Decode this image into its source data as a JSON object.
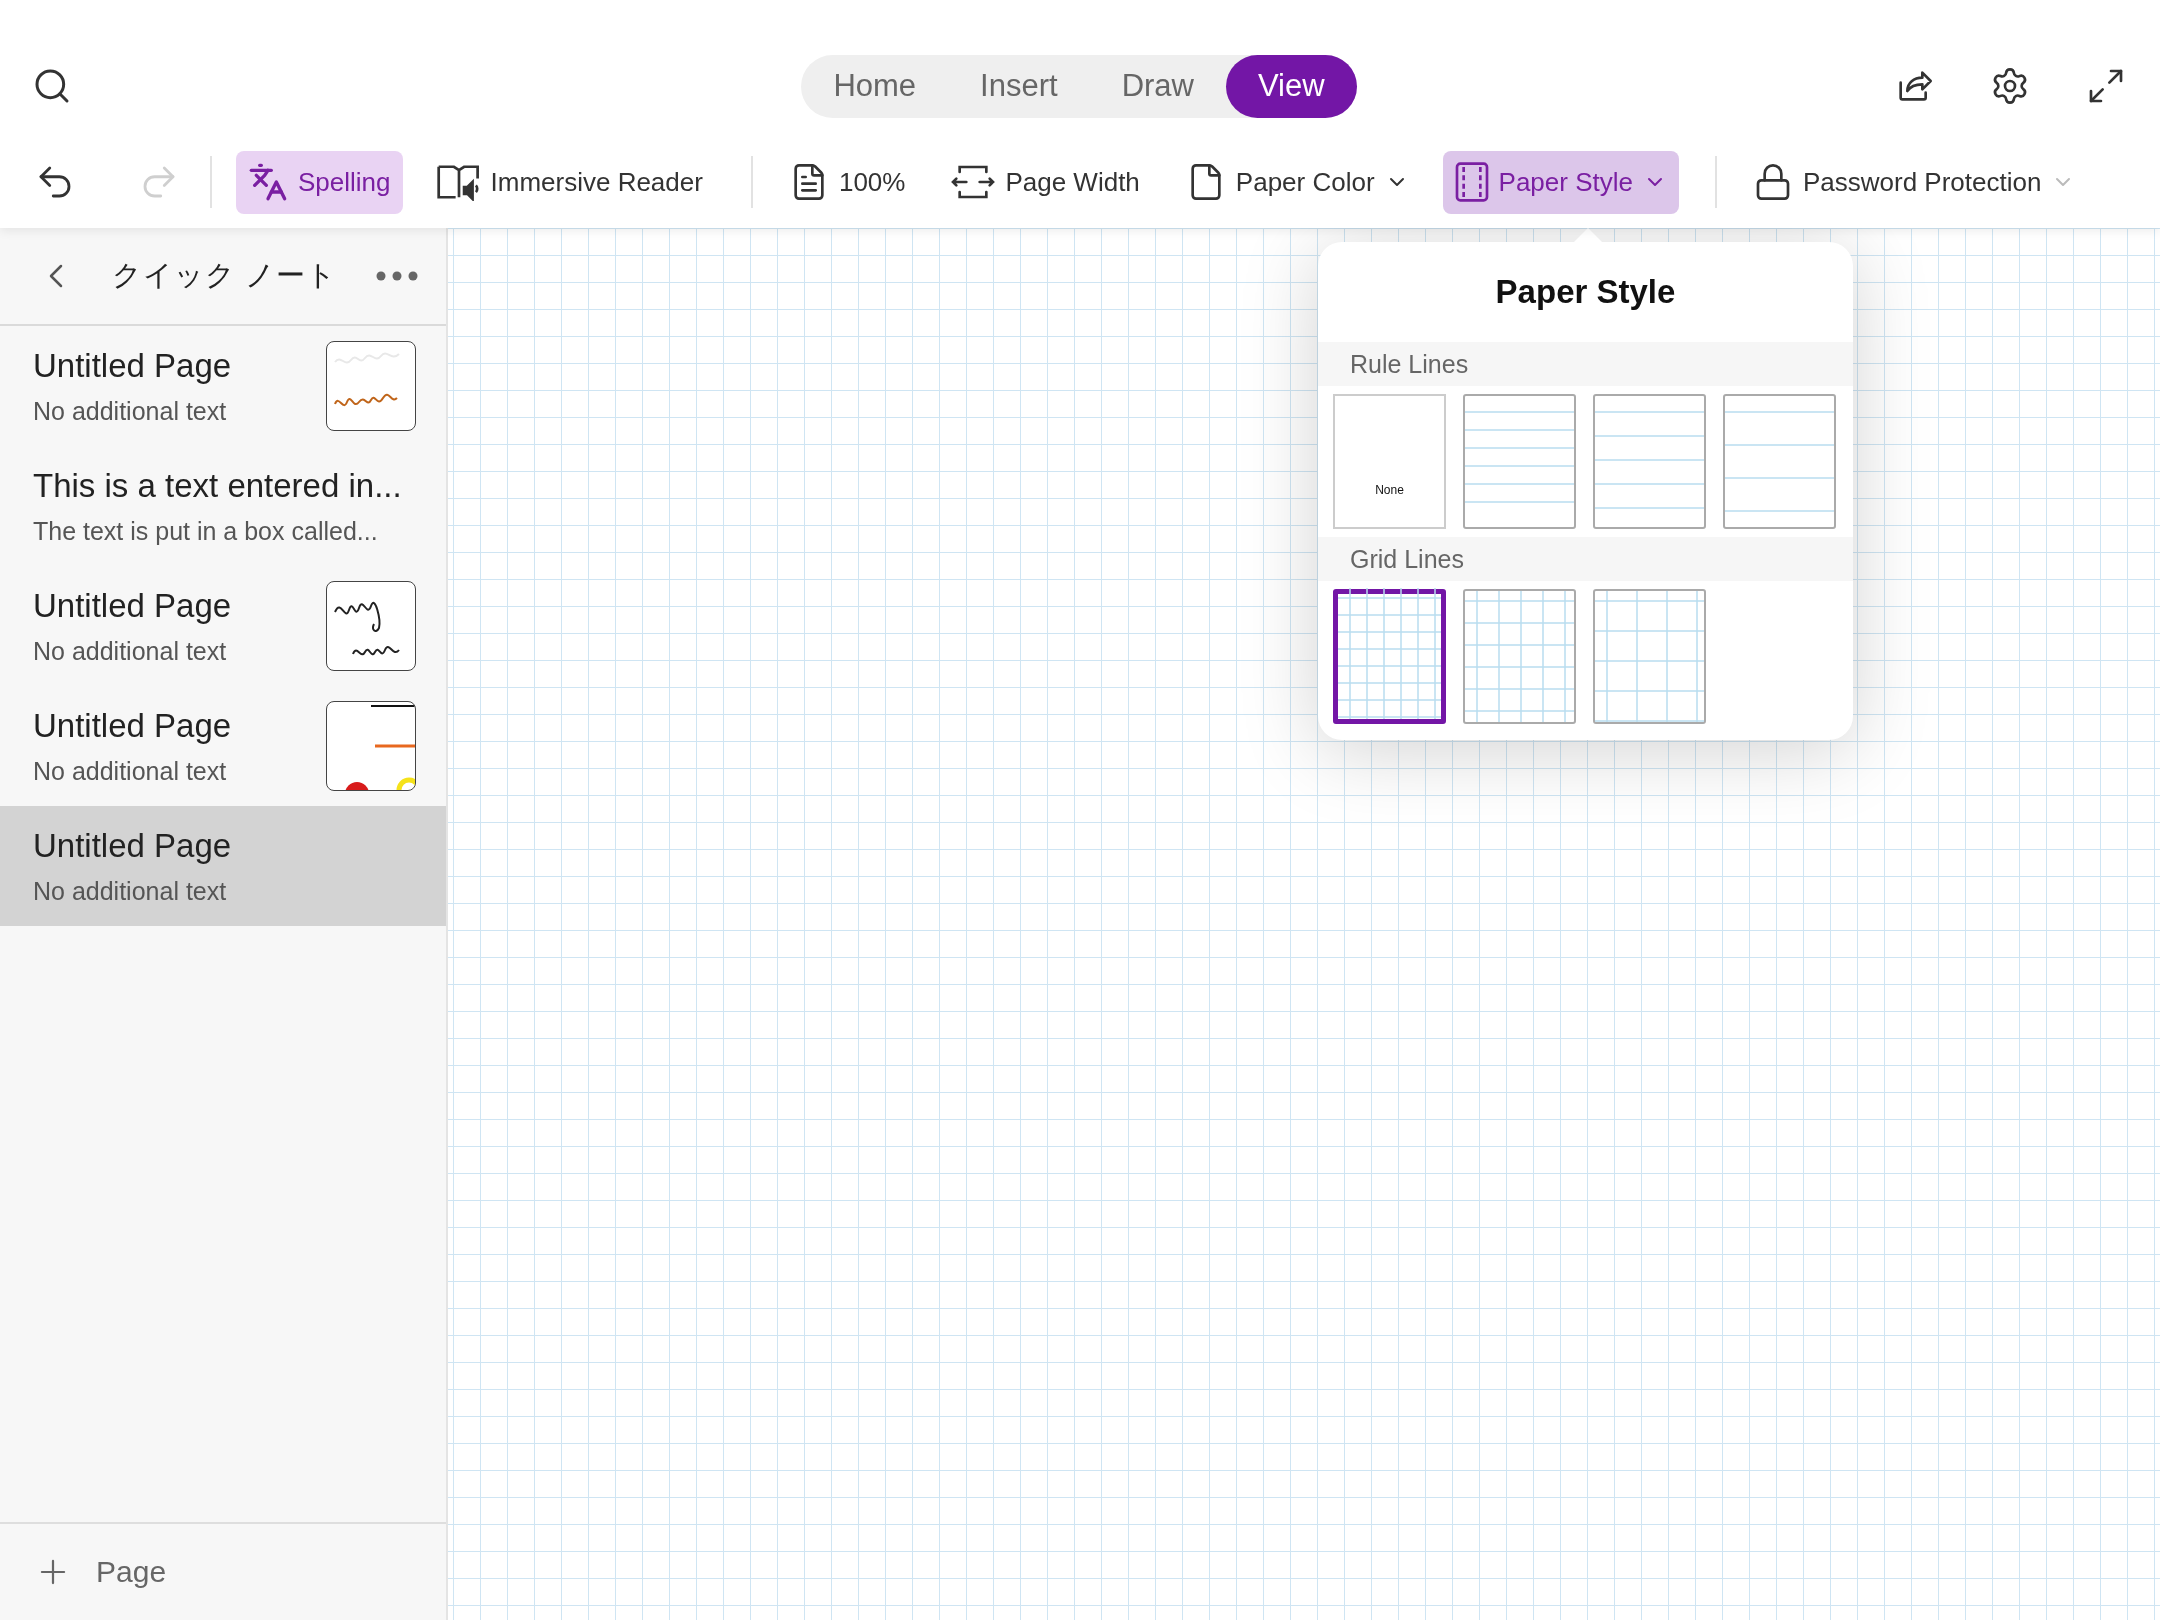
{
  "top_bar": {
    "tabs": [
      {
        "label": "Home",
        "selected": false
      },
      {
        "label": "Insert",
        "selected": false
      },
      {
        "label": "Draw",
        "selected": false
      },
      {
        "label": "View",
        "selected": true
      }
    ]
  },
  "ribbon": {
    "undo": {
      "disabled": false
    },
    "redo": {
      "disabled": true
    },
    "groups": [
      [
        {
          "label": "Spelling",
          "active": true,
          "dropdown": false
        },
        {
          "label": "Immersive Reader",
          "active": false,
          "dropdown": false
        }
      ],
      [
        {
          "label": "100%",
          "active": false,
          "dropdown": false
        },
        {
          "label": "Page Width",
          "active": false,
          "dropdown": false
        },
        {
          "label": "Paper Color",
          "active": false,
          "dropdown": true
        },
        {
          "label": "Paper Style",
          "active": true,
          "dropdown": true
        }
      ],
      [
        {
          "label": "Password Protection",
          "active": false,
          "dropdown": true
        }
      ]
    ]
  },
  "sidebar": {
    "title": "クイック ノート",
    "pages": [
      {
        "title": "Untitled Page",
        "preview": "No additional text",
        "selected": false
      },
      {
        "title": "This is a text entered in...",
        "preview": "The text is put in a box called...",
        "selected": false
      },
      {
        "title": "Untitled Page",
        "preview": "No additional text",
        "selected": false
      },
      {
        "title": "Untitled Page",
        "preview": "No additional text",
        "selected": false
      },
      {
        "title": "Untitled Page",
        "preview": "No additional text",
        "selected": true
      }
    ],
    "add_page": "Page"
  },
  "paper_style_popup": {
    "title": "Paper Style",
    "sections": [
      {
        "title": "Rule Lines",
        "options": [
          {
            "kind": "blank",
            "label": "None",
            "selected": false
          },
          {
            "kind": "narrow",
            "selected": false
          },
          {
            "kind": "college",
            "selected": false
          },
          {
            "kind": "wide",
            "selected": false
          }
        ]
      },
      {
        "title": "Grid Lines",
        "options": [
          {
            "kind": "small",
            "selected": true
          },
          {
            "kind": "medium",
            "selected": false
          },
          {
            "kind": "large",
            "selected": false
          }
        ]
      }
    ]
  }
}
